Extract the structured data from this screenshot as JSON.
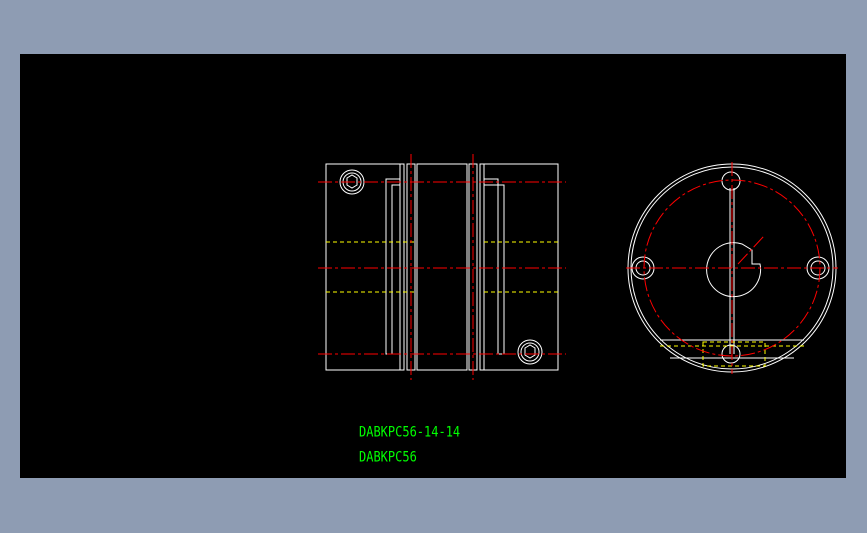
{
  "drawing": {
    "part_number": "DABKPC56-14-14",
    "series": "DABKPC56"
  },
  "colors": {
    "app_background": "#8e9cb3",
    "canvas_background": "#000000",
    "outline": "#ffffff",
    "centerline": "#ff0000",
    "hidden_line": "#ffff00",
    "text": "#00ff00"
  }
}
